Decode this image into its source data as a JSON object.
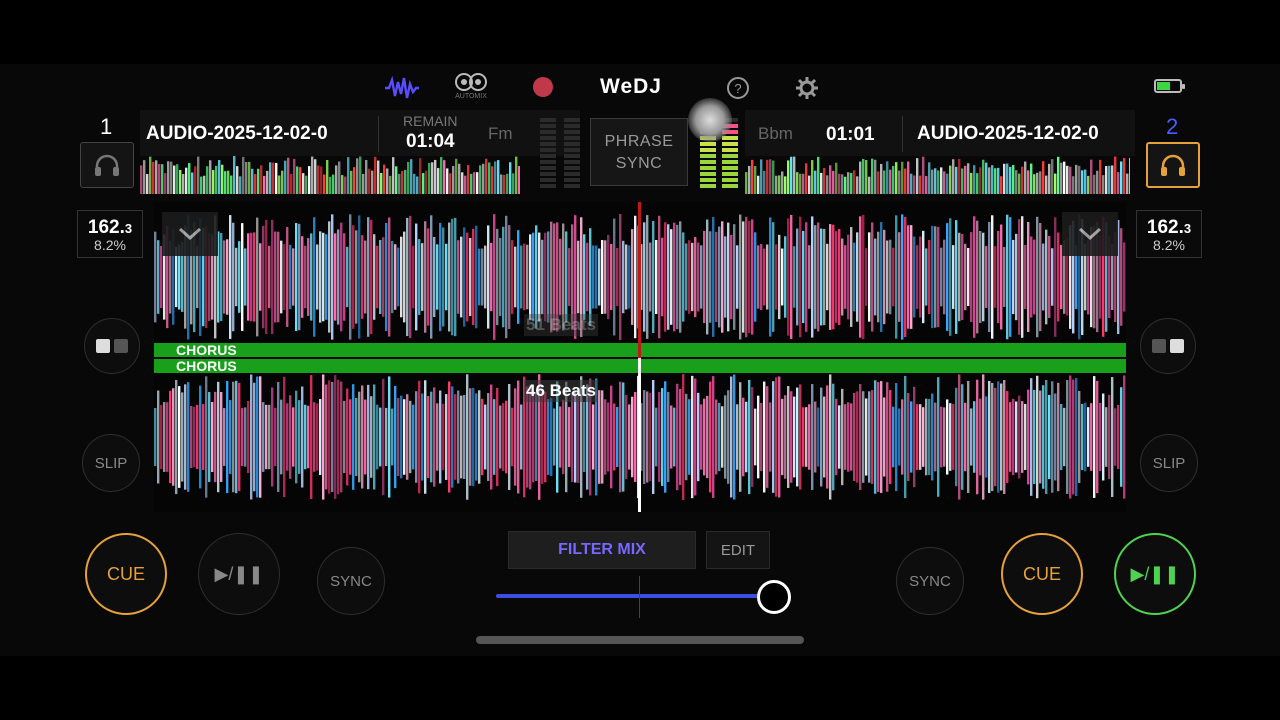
{
  "app": {
    "logo": "WeDJ",
    "automix_label": "AUTOMIX"
  },
  "colors": {
    "accent_orange": "#e6a23a",
    "accent_green": "#4fd24f",
    "accent_blue": "#7766ff",
    "phrase_green": "#19a01a",
    "battery_green": "#3bd640"
  },
  "deck1": {
    "number": "1",
    "title": "AUDIO-2025-12-02-0",
    "remain_label": "REMAIN",
    "time": "01:04",
    "key": "Fm",
    "bpm_main": "162.",
    "bpm_dec": "3",
    "pitch": "8.2%",
    "slip": "SLIP",
    "cue": "CUE",
    "sync": "SYNC",
    "play_icon": "▶/❚❚"
  },
  "deck2": {
    "number": "2",
    "title": "AUDIO-2025-12-02-0",
    "time": "01:01",
    "key": "Bbm",
    "bpm_main": "162.",
    "bpm_dec": "3",
    "pitch": "8.2%",
    "slip": "SLIP",
    "cue": "CUE",
    "sync": "SYNC",
    "play_icon": "▶/❚❚"
  },
  "center": {
    "phrase_sync_line1": "PHRASE",
    "phrase_sync_line2": "SYNC",
    "phrase_top": "CHORUS",
    "phrase_bottom": "CHORUS",
    "beats_top": "51 Beats",
    "beats_bottom": "46 Beats"
  },
  "mixer": {
    "filter_mix": "FILTER MIX",
    "edit": "EDIT",
    "crossfader_position": 0.98
  }
}
